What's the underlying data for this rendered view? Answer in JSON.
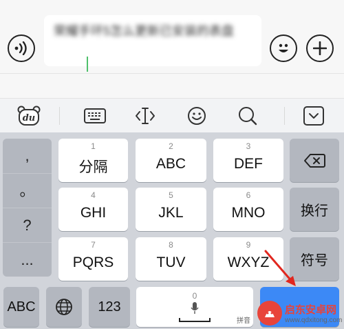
{
  "compose": {
    "message_text": "荣耀手环5怎么更新已安装的表盘",
    "accent_color": "#4ec06b"
  },
  "icons": {
    "voice": "voice-icon",
    "emoji": "emoji-icon",
    "plus": "plus-icon",
    "du": "baidu-du-icon",
    "keyboard": "keyboard-icon",
    "cursor": "cursor-move-icon",
    "face": "face-icon",
    "search": "search-icon",
    "collapse": "collapse-keyboard-icon",
    "backspace": "backspace-icon",
    "globe": "globe-icon",
    "mic": "microphone-icon"
  },
  "keyboard": {
    "punctuation": [
      ",",
      "。",
      "?",
      "..."
    ],
    "keys": [
      {
        "num": "1",
        "label": "分隔"
      },
      {
        "num": "2",
        "label": "ABC"
      },
      {
        "num": "3",
        "label": "DEF"
      },
      {
        "num": "4",
        "label": "GHI"
      },
      {
        "num": "5",
        "label": "JKL"
      },
      {
        "num": "6",
        "label": "MNO"
      },
      {
        "num": "7",
        "label": "PQRS"
      },
      {
        "num": "8",
        "label": "TUV"
      },
      {
        "num": "9",
        "label": "WXYZ"
      }
    ],
    "newline_label": "换行",
    "symbol_label": "符号",
    "abc_label": "ABC",
    "num_label": "123",
    "space_num": "0",
    "pinyin_label": "拼音",
    "enter_color": "#3c89f6"
  },
  "watermark": {
    "title": "启东安卓网",
    "url": "www.qdxitong.com"
  }
}
